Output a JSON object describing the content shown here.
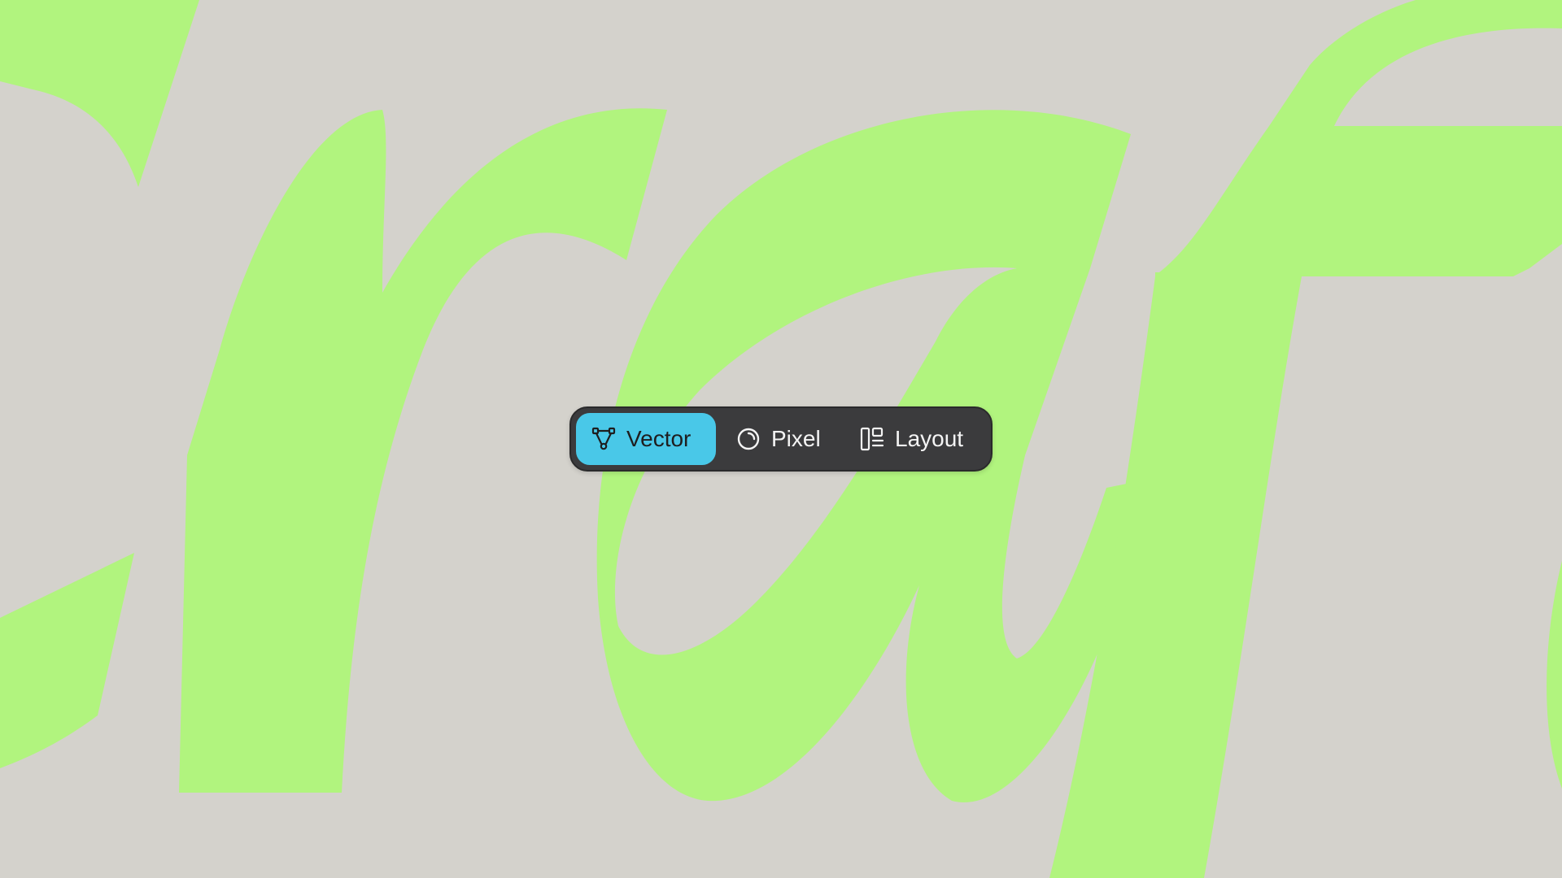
{
  "colors": {
    "background": "#d4d2cc",
    "letterforms": "#b1f47e",
    "switcher_background": "#3b3b3d",
    "active_segment": "#49c8e8",
    "active_text": "#1e1e1f",
    "inactive_text": "#f4f4f4"
  },
  "mode_switcher": {
    "selected": "Vector",
    "items": [
      {
        "label": "Vector",
        "icon": "vector-pen-nodes-icon",
        "active": true
      },
      {
        "label": "Pixel",
        "icon": "pixel-circle-icon",
        "active": false
      },
      {
        "label": "Layout",
        "icon": "layout-columns-icon",
        "active": false
      }
    ]
  }
}
